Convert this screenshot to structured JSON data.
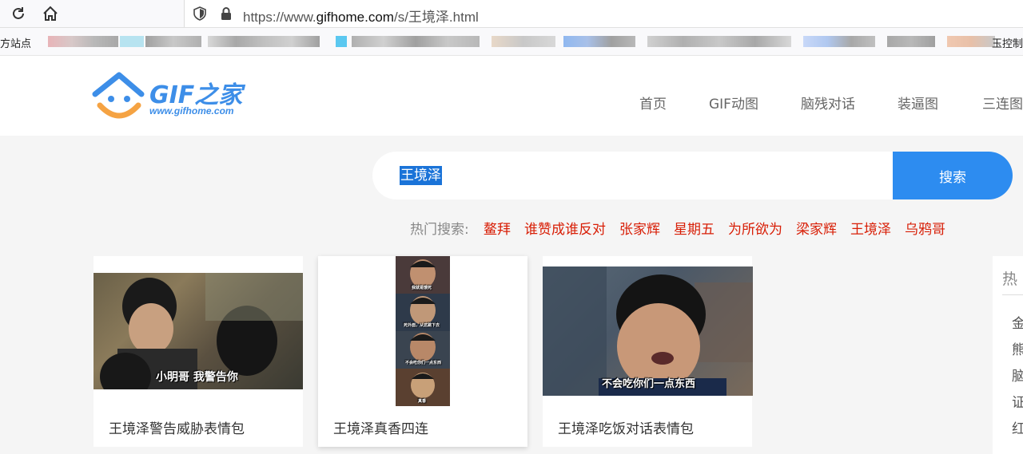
{
  "browser": {
    "url_prefix": "https://www.",
    "url_domain": "gifhome.com",
    "url_path": "/s/王境泽.html",
    "bookmarks_left_label": "方站点",
    "bookmarks_right_label": "玉控制"
  },
  "site": {
    "logo_text": "GIF之家",
    "logo_url": "www.gifhome.com",
    "nav": [
      "首页",
      "GIF动图",
      "脑残对话",
      "装逼图",
      "三连图"
    ]
  },
  "search": {
    "query": "王境泽",
    "button_label": "搜索",
    "hot_label": "热门搜索:",
    "hot_items": [
      "鳌拜",
      "谁赞成谁反对",
      "张家辉",
      "星期五",
      "为所欲为",
      "梁家辉",
      "王境泽",
      "乌鸦哥"
    ]
  },
  "results": [
    {
      "title": "王境泽警告威胁表情包",
      "caption": "小明哥 我警告你"
    },
    {
      "title": "王境泽真香四连",
      "captions": [
        "我就是饿死",
        "死外面，从这跳下去",
        "不会吃你们一点东西",
        "真香"
      ]
    },
    {
      "title": "王境泽吃饭对话表情包",
      "caption": "不会吃你们一点东西"
    }
  ],
  "sidebar": {
    "heading": "热",
    "items": [
      "金",
      "熊",
      "脑",
      "证",
      "红"
    ]
  },
  "colors": {
    "accent": "#2d8cf0",
    "hot_item": "#d81e06",
    "logo": "#3d8ee8"
  }
}
